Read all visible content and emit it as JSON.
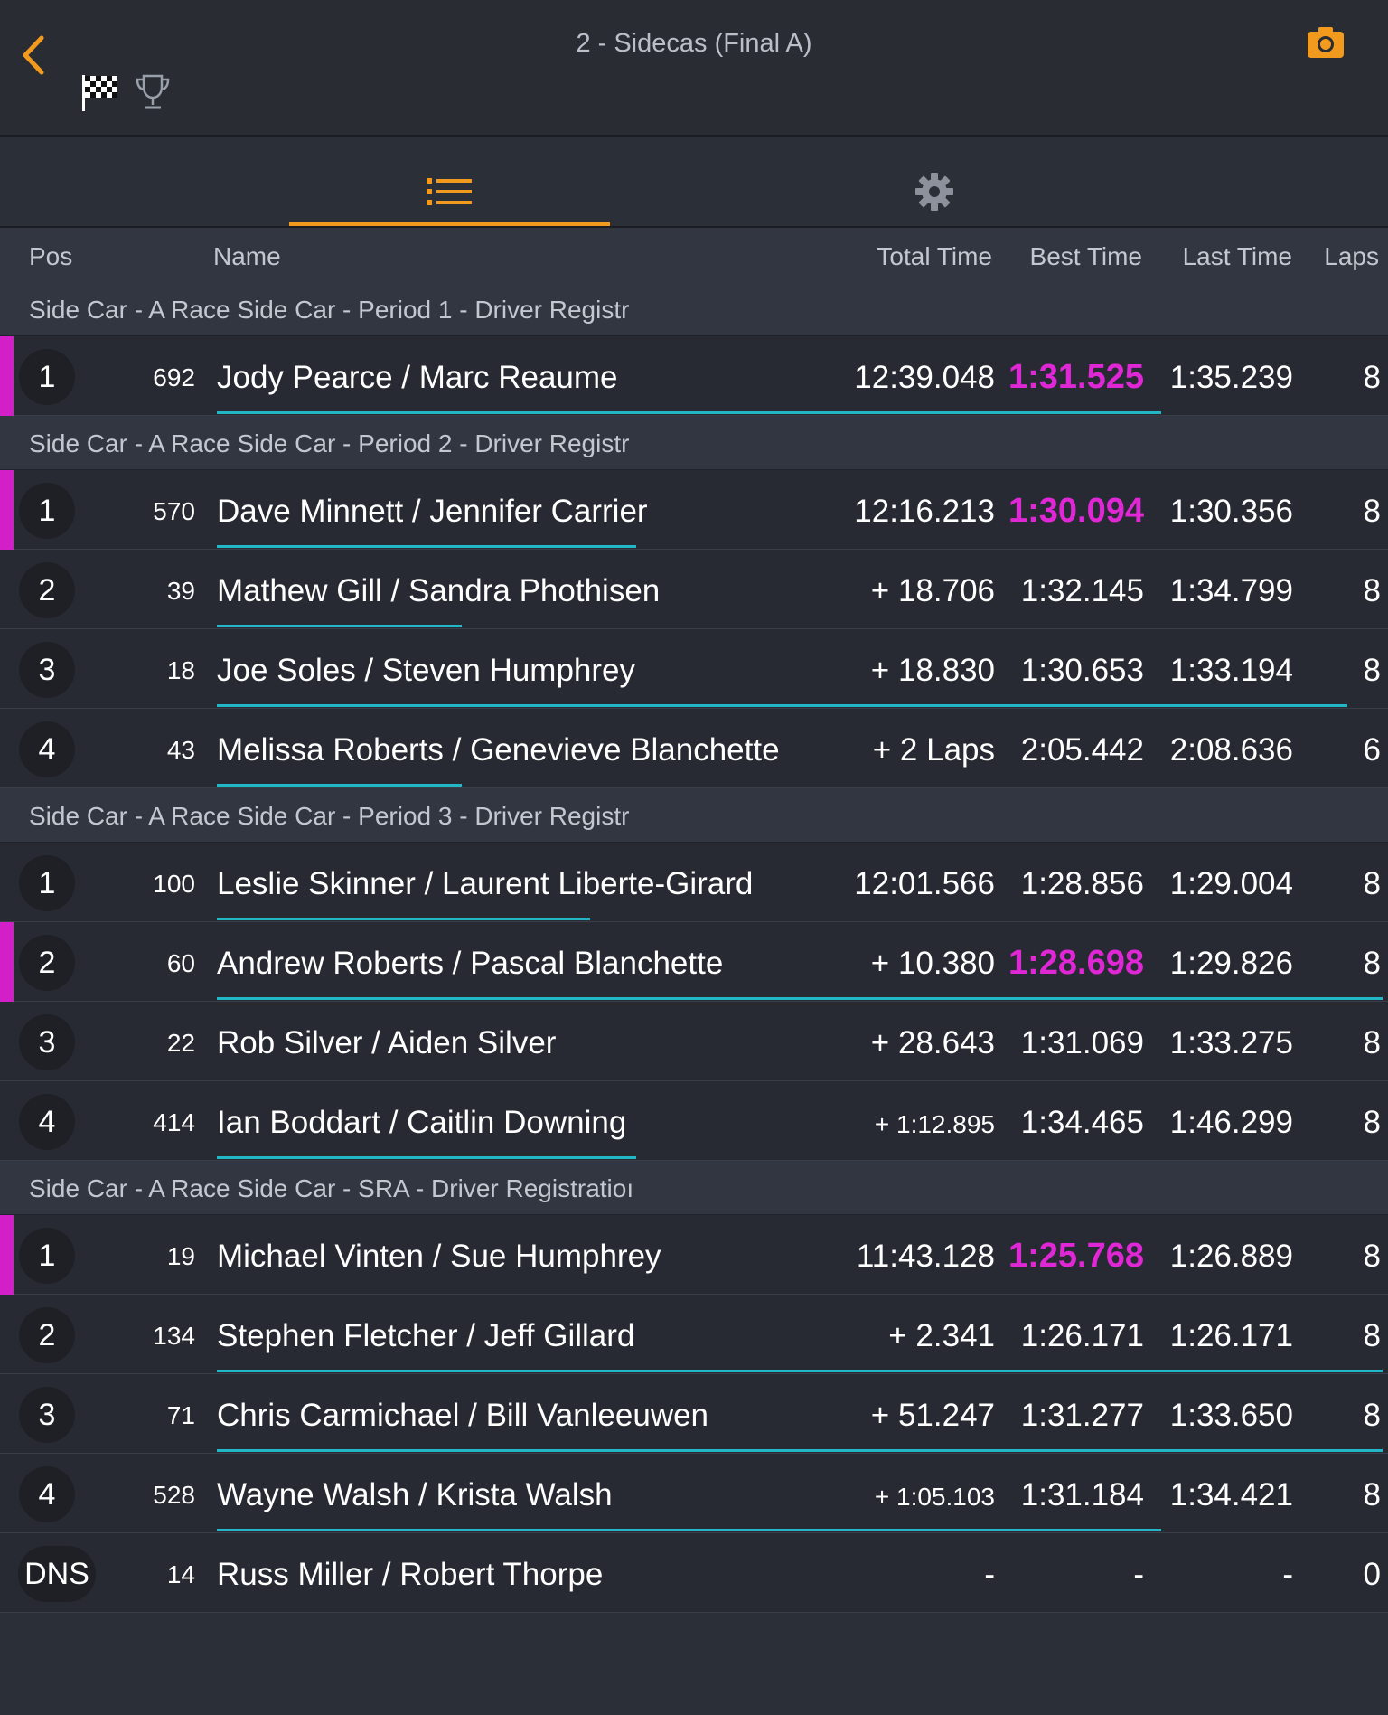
{
  "header": {
    "title": "2 - Sidecas (Final A)",
    "accent_color": "#f29a1e"
  },
  "tabs": [
    {
      "icon": "list-icon",
      "active": true
    },
    {
      "icon": "gear-icon",
      "active": false
    }
  ],
  "columns": {
    "pos": "Pos",
    "name": "Name",
    "total": "Total Time",
    "best": "Best Time",
    "last": "Last Time",
    "laps": "Laps"
  },
  "colors": {
    "fastest_marker": "#d21fc8",
    "best_highlight": "#e027d6",
    "progress": "#21b7c7"
  },
  "groups": [
    {
      "title": "Side Car - A Race Side Car - Period 1 - Driver Registr",
      "rows": [
        {
          "pos": "1",
          "kart": "692",
          "name": "Jody Pearce /  Marc Reaume",
          "total": "12:39.048",
          "best": "1:31.525",
          "last": "1:35.239",
          "laps": "8",
          "fastest": true,
          "progress": 0.81
        }
      ]
    },
    {
      "title": "Side Car - A Race Side Car - Period 2 - Driver Registr",
      "rows": [
        {
          "pos": "1",
          "kart": "570",
          "name": "Dave Minnett /  Jennifer Carrier",
          "total": "12:16.213",
          "best": "1:30.094",
          "last": "1:30.356",
          "laps": "8",
          "fastest": true,
          "progress": 0.36
        },
        {
          "pos": "2",
          "kart": "39",
          "name": "Mathew Gill /  Sandra Phothisen",
          "total": "+ 18.706",
          "best": "1:32.145",
          "last": "1:34.799",
          "laps": "8",
          "fastest": false,
          "progress": 0.21
        },
        {
          "pos": "3",
          "kart": "18",
          "name": "Joe Soles /  Steven Humphrey",
          "total": "+ 18.830",
          "best": "1:30.653",
          "last": "1:33.194",
          "laps": "8",
          "fastest": false,
          "progress": 0.97
        },
        {
          "pos": "4",
          "kart": "43",
          "name": "Melissa Roberts /  Genevieve Blanchette",
          "total": "+ 2 Laps",
          "best": "2:05.442",
          "last": "2:08.636",
          "laps": "6",
          "fastest": false,
          "progress": 0.21
        }
      ]
    },
    {
      "title": "Side Car - A Race Side Car - Period 3 - Driver Registr",
      "rows": [
        {
          "pos": "1",
          "kart": "100",
          "name": "Leslie Skinner /  Laurent Liberte-Girard",
          "total": "12:01.566",
          "best": "1:28.856",
          "last": "1:29.004",
          "laps": "8",
          "fastest": false,
          "progress": 0.32
        },
        {
          "pos": "2",
          "kart": "60",
          "name": "Andrew Roberts /  Pascal Blanchette",
          "total": "+ 10.380",
          "best": "1:28.698",
          "last": "1:29.826",
          "laps": "8",
          "fastest": true,
          "progress": 1.0
        },
        {
          "pos": "3",
          "kart": "22",
          "name": "Rob Silver /  Aiden Silver",
          "total": "+ 28.643",
          "best": "1:31.069",
          "last": "1:33.275",
          "laps": "8",
          "fastest": false,
          "progress": 0.0
        },
        {
          "pos": "4",
          "kart": "414",
          "name": "Ian Boddart /  Caitlin Downing",
          "total": "+ 1:12.895",
          "best": "1:34.465",
          "last": "1:46.299",
          "laps": "8",
          "fastest": false,
          "progress": 0.36,
          "small_total": true
        }
      ]
    },
    {
      "title": "Side Car - A Race Side Car - SRA - Driver Registratioı",
      "rows": [
        {
          "pos": "1",
          "kart": "19",
          "name": "Michael Vinten /  Sue Humphrey",
          "total": "11:43.128",
          "best": "1:25.768",
          "last": "1:26.889",
          "laps": "8",
          "fastest": true,
          "progress": 0.0
        },
        {
          "pos": "2",
          "kart": "134",
          "name": "Stephen Fletcher /  Jeff Gillard",
          "total": "+ 2.341",
          "best": "1:26.171",
          "last": "1:26.171",
          "laps": "8",
          "fastest": false,
          "progress": 1.0
        },
        {
          "pos": "3",
          "kart": "71",
          "name": "Chris Carmichael /  Bill Vanleeuwen",
          "total": "+ 51.247",
          "best": "1:31.277",
          "last": "1:33.650",
          "laps": "8",
          "fastest": false,
          "progress": 1.0
        },
        {
          "pos": "4",
          "kart": "528",
          "name": "Wayne Walsh /  Krista Walsh",
          "total": "+ 1:05.103",
          "best": "1:31.184",
          "last": "1:34.421",
          "laps": "8",
          "fastest": false,
          "progress": 0.81,
          "small_total": true
        },
        {
          "pos": "DNS",
          "kart": "14",
          "name": "Russ Miller /  Robert Thorpe",
          "total": "-",
          "best": "-",
          "last": "-",
          "laps": "0",
          "fastest": false,
          "progress": 0.0
        }
      ]
    }
  ]
}
